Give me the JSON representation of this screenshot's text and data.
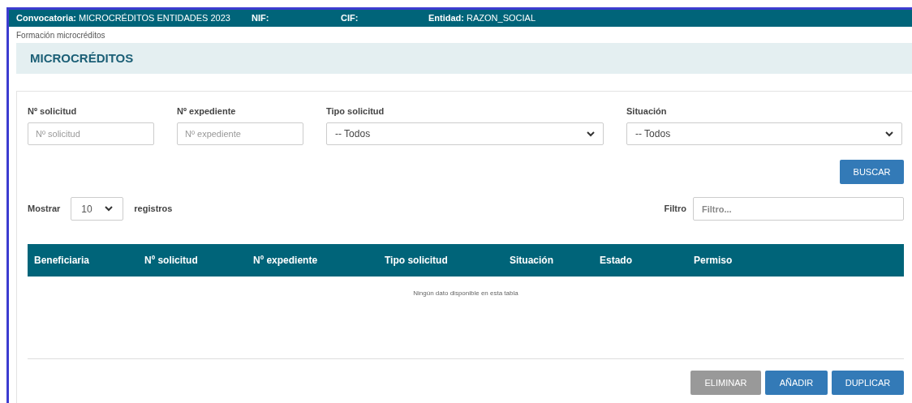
{
  "header": [
    {
      "label": "Convocatoria:",
      "value": "MICROCRÉDITOS ENTIDADES 2023"
    },
    {
      "label": "NIF:"
    },
    {
      "label": "CIF:"
    },
    {
      "label": "Entidad:",
      "value": "RAZON_SOCIAL"
    }
  ],
  "breadcrumb": "Formación microcréditos",
  "title": "MICROCRÉDITOS",
  "filters": [
    {
      "kind": "input",
      "label": "Nº solicitud",
      "placeholder": "Nº solicitud"
    },
    {
      "kind": "input",
      "label": "Nº expediente",
      "placeholder": "Nº expediente"
    },
    {
      "kind": "select",
      "label": "Tipo solicitud",
      "value": "-- Todos"
    },
    {
      "kind": "select",
      "label": "Situación",
      "value": "-- Todos"
    }
  ],
  "search_button": "BUSCAR",
  "length": {
    "label_before": "Mostrar",
    "value": "10",
    "label_after": "registros"
  },
  "filter": {
    "label": "Filtro",
    "placeholder": "Filtro..."
  },
  "table": {
    "columns": [
      "Beneficiaria",
      "Nº solicitud",
      "Nº expediente",
      "Tipo solicitud",
      "Situación",
      "Estado",
      "Permiso"
    ],
    "empty": "Ningún dato disponible en esta tabla"
  },
  "actions": [
    {
      "label": "ELIMINAR",
      "disabled": true
    },
    {
      "label": "AÑADIR",
      "disabled": false
    },
    {
      "label": "DUPLICAR",
      "disabled": false
    }
  ]
}
